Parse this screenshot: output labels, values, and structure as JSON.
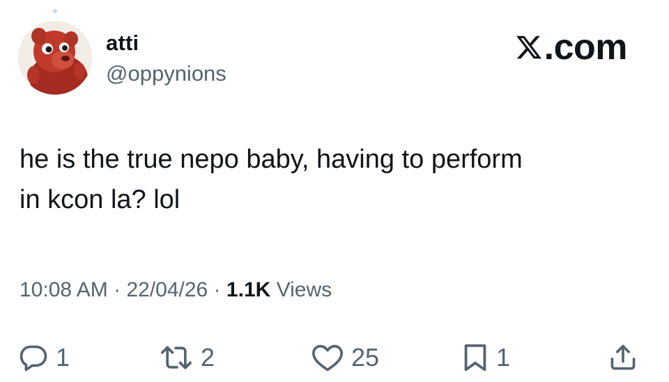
{
  "author": {
    "display_name": "atti",
    "handle": "@oppynions",
    "avatar_icon": "red-plush-character-avatar"
  },
  "brand": {
    "label": ".com",
    "icon": "x-logo-icon"
  },
  "tweet": {
    "lines": [
      "he is the true nepo baby, having to perform",
      "in kcon la? lol"
    ]
  },
  "meta": {
    "time": "10:08 AM",
    "separator": "·",
    "date": "22/04/26",
    "views_count": "1.1K",
    "views_label": "Views"
  },
  "actions": {
    "replies": "1",
    "reposts": "2",
    "likes": "25",
    "bookmarks": "1"
  },
  "colors": {
    "text": "#0f1419",
    "secondary": "#536471",
    "icon": "#536471",
    "avatar_red": "#c0392b"
  }
}
